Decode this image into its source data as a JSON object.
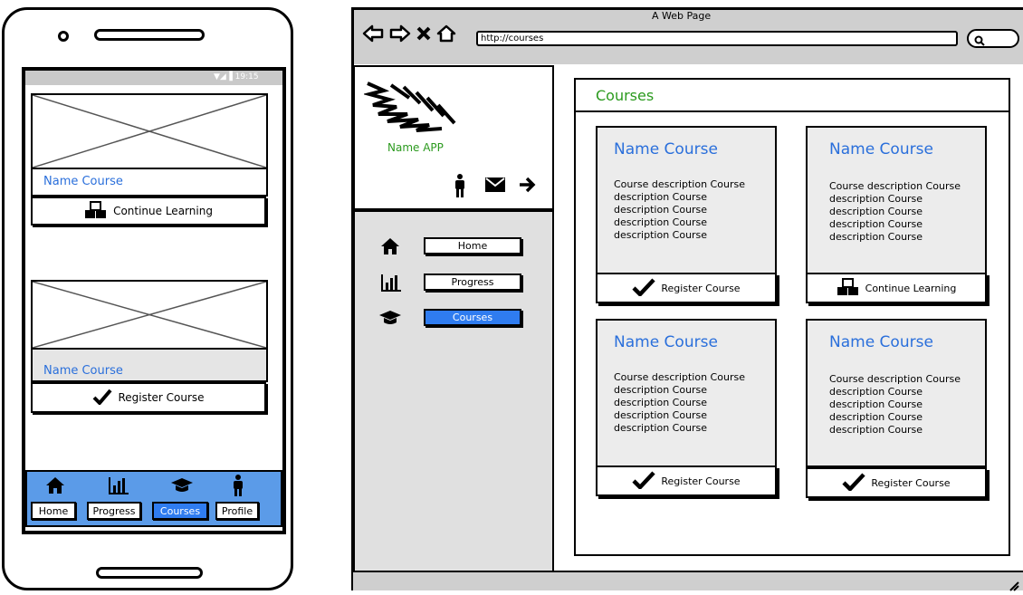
{
  "mobile": {
    "status": "▼◢▐ 19:15",
    "cards": [
      {
        "name": "Name Course",
        "action": "Continue Learning",
        "action_icon": "cubes-icon"
      },
      {
        "name": "Name Course",
        "action": "Register Course",
        "action_icon": "checkmark-icon"
      }
    ],
    "tabs": [
      {
        "label": "Home",
        "icon": "home-icon",
        "active": false
      },
      {
        "label": "Progress",
        "icon": "bar-chart-icon",
        "active": false
      },
      {
        "label": "Courses",
        "icon": "graduation-cap-icon",
        "active": true
      },
      {
        "label": "Profile",
        "icon": "person-icon",
        "active": false
      }
    ]
  },
  "browser": {
    "window_title": "A Web Page",
    "url": "http://courses",
    "app_name": "Name APP",
    "nav": [
      {
        "label": "Home",
        "icon": "home-icon",
        "active": false
      },
      {
        "label": "Progress",
        "icon": "bar-chart-icon",
        "active": false
      },
      {
        "label": "Courses",
        "icon": "graduation-cap-icon",
        "active": true
      }
    ],
    "page_title": "Courses",
    "courses": [
      {
        "title": "Name Course",
        "desc": [
          "Course description  Course",
          "description  Course",
          "description  Course",
          "description  Course",
          "description  Course"
        ],
        "action": "Register Course",
        "action_icon": "checkmark-icon"
      },
      {
        "title": "Name Course",
        "desc": [
          "Course description  Course",
          "description  Course",
          "description  Course",
          "description  Course",
          "description  Course"
        ],
        "action": "Continue Learning",
        "action_icon": "cubes-icon"
      },
      {
        "title": "Name Course",
        "desc": [
          "Course description  Course",
          "description  Course",
          "description  Course",
          "description  Course",
          "description  Course"
        ],
        "action": "Register Course",
        "action_icon": "checkmark-icon"
      },
      {
        "title": "Name Course",
        "desc": [
          "Course description  Course",
          "description  Course",
          "description  Course",
          "description  Course",
          "description  Course"
        ],
        "action": "Register Course",
        "action_icon": "checkmark-icon"
      }
    ]
  },
  "colors": {
    "link_blue": "#2a6fdb",
    "accent_green": "#2b9a1e",
    "active_blue": "#2f7cf0",
    "tabbar_blue": "#5b9be8"
  }
}
